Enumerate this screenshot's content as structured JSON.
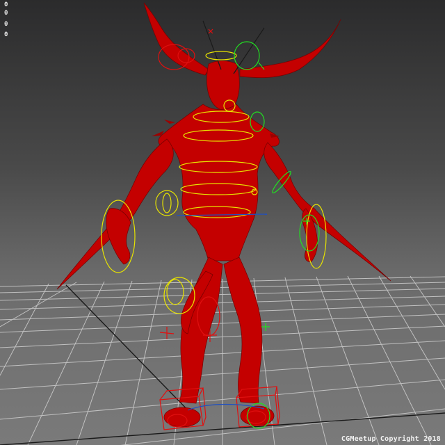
{
  "hud": {
    "stats": [
      "0",
      "0",
      "0",
      "0"
    ]
  },
  "watermark": {
    "text": "CGMeetup Copyright 2018"
  },
  "colors": {
    "background_top": "#2b2b2c",
    "background_bottom": "#7a7a7a",
    "grid": "#cfcfcf",
    "grid_axis": "#1a1a1a",
    "character": "#c40000",
    "controller_yellow": "#e8e400",
    "controller_red": "#e01010",
    "controller_green": "#22e022",
    "controller_blue": "#2050c0"
  },
  "scene": {
    "character": "demon-rig",
    "icons": [
      "viewport-grid",
      "rig-controllers"
    ]
  }
}
